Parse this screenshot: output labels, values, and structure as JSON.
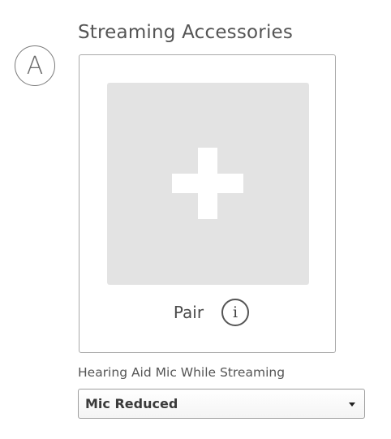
{
  "callout": {
    "letter": "A"
  },
  "section": {
    "title": "Streaming Accessories"
  },
  "pair_tile": {
    "icon": "plus-icon"
  },
  "pair": {
    "label": "Pair",
    "info_icon": "info-icon",
    "info_glyph": "i"
  },
  "mic_setting": {
    "label": "Hearing Aid Mic While Streaming",
    "selected_value": "Mic Reduced"
  }
}
